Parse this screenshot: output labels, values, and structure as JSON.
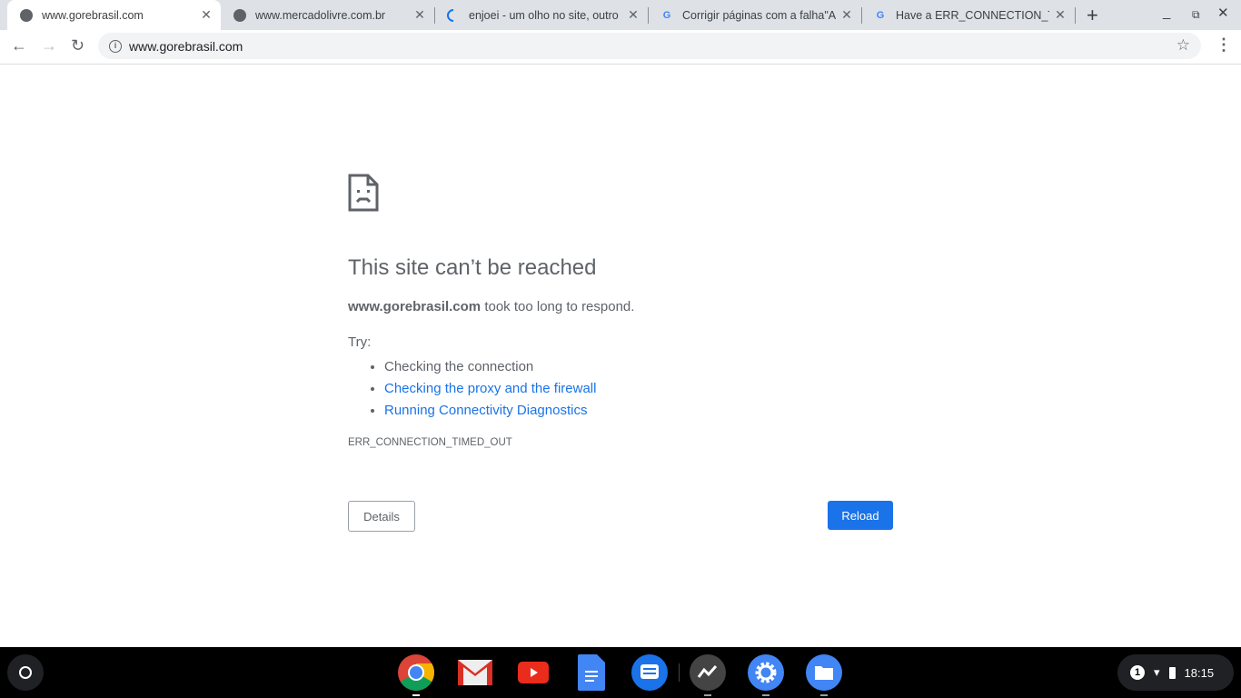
{
  "tabs": [
    {
      "title": "www.gorebrasil.com",
      "icon": "globe-icon",
      "active": true
    },
    {
      "title": "www.mercadolivre.com.br",
      "icon": "globe-icon",
      "active": false
    },
    {
      "title": "enjoei - um olho no site, outro no app",
      "icon": "loading-spinner-icon",
      "active": false
    },
    {
      "title": "Corrigir páginas com a falha\"AI",
      "icon": "google-icon",
      "active": false
    },
    {
      "title": "Have a ERR_CONNECTION_TIMED_OUT",
      "icon": "google-icon",
      "active": false
    }
  ],
  "omnibox": {
    "url": "www.gorebrasil.com"
  },
  "error": {
    "title": "This site can’t be reached",
    "host": "www.gorebrasil.com",
    "message": " took too long to respond.",
    "try": "Try:",
    "suggestions": [
      "Checking the connection",
      "Checking the proxy and the firewall",
      "Running Connectivity Diagnostics"
    ],
    "code": "ERR_CONNECTION_TIMED_OUT",
    "details_label": "Details",
    "reload_label": "Reload"
  },
  "shelf": {
    "apps": [
      "chrome",
      "gmail",
      "youtube",
      "docs",
      "messages",
      "stats",
      "settings",
      "files"
    ],
    "notification_count": "1",
    "time": "18:15"
  },
  "colors": {
    "accent": "#1a73e8",
    "tabstrip": "#dee1e6"
  }
}
